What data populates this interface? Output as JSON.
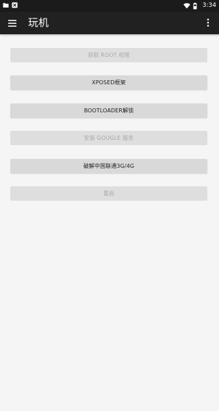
{
  "status_bar": {
    "time": "3:34",
    "left_icons": [
      "folder-icon",
      "app-notification-icon"
    ],
    "right_icons": [
      "wifi-icon",
      "battery-icon"
    ]
  },
  "toolbar": {
    "title": "玩机",
    "menu_icon": "hamburger-menu-icon",
    "more_icon": "overflow-menu-icon"
  },
  "buttons": [
    {
      "label": "获取 ROOT 权限",
      "enabled": false
    },
    {
      "label": "XPOSED框架",
      "enabled": true
    },
    {
      "label": "BOOTLOADER解锁",
      "enabled": true
    },
    {
      "label": "安装 GOOGLE 服务",
      "enabled": false
    },
    {
      "label": "破解中国联通3G/4G",
      "enabled": true
    },
    {
      "label": "重启",
      "enabled": false
    }
  ],
  "colors": {
    "status_bar": "#1b1b1b",
    "toolbar": "#212121",
    "background": "#f5f5f5",
    "button": "#d9d9d9",
    "button_text": "#222222",
    "button_text_disabled": "#a9a9a9"
  }
}
